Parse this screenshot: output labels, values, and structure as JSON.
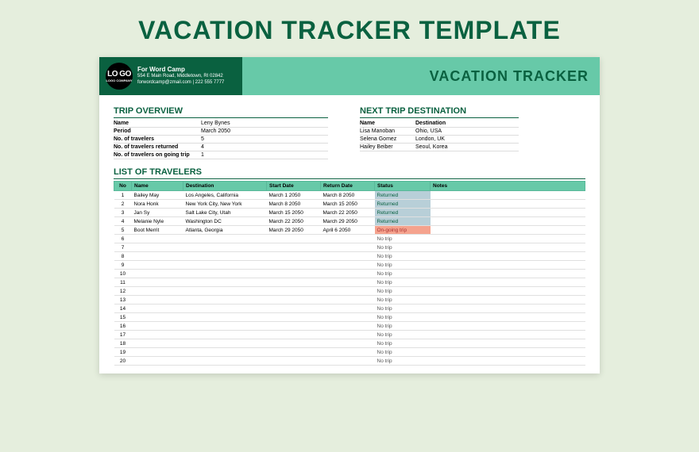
{
  "pageTitle": "VACATION TRACKER TEMPLATE",
  "header": {
    "logoMain": "LO GO",
    "logoSub": "LOGO COMPANY",
    "companyName": "For Word Camp",
    "address": "554 E Main Road, Middletown, RI 02842",
    "contact": "forwordcamp@zmail.com | 222 555 7777",
    "trackerTitle": "VACATION TRACKER"
  },
  "overview": {
    "title": "TRIP OVERVIEW",
    "rows": [
      {
        "label": "Name",
        "value": "Leny Bynes"
      },
      {
        "label": "Period",
        "value": "March 2050"
      },
      {
        "label": "No. of travelers",
        "value": "5"
      },
      {
        "label": "No. of travelers returned",
        "value": "4"
      },
      {
        "label": "No. of travelers on going trip",
        "value": "1"
      }
    ]
  },
  "nextTrip": {
    "title": "NEXT TRIP DESTINATION",
    "hName": "Name",
    "hDest": "Destination",
    "rows": [
      {
        "name": "Lisa Manoban",
        "dest": "Ohio, USA"
      },
      {
        "name": "Selena Gomez",
        "dest": "London, UK"
      },
      {
        "name": "Hailey Beiber",
        "dest": "Seoul, Korea"
      }
    ]
  },
  "travelers": {
    "title": "LIST OF TRAVELERS",
    "headers": {
      "no": "No",
      "name": "Name",
      "dest": "Destination",
      "start": "Start Date",
      "return": "Return Date",
      "status": "Status",
      "notes": "Notes"
    },
    "rows": [
      {
        "no": "1",
        "name": "Bailey May",
        "dest": "Los Angeles, California",
        "start": "March 1 2050",
        "return": "March 8 2050",
        "status": "Returned",
        "statusClass": "status-returned"
      },
      {
        "no": "2",
        "name": "Nora Honk",
        "dest": "New York City, New York",
        "start": "March 8 2050",
        "return": "March 15 2050",
        "status": "Returned",
        "statusClass": "status-returned"
      },
      {
        "no": "3",
        "name": "Jan Sy",
        "dest": "Salt Lake City, Utah",
        "start": "March 15 2050",
        "return": "March 22 2050",
        "status": "Returned",
        "statusClass": "status-returned"
      },
      {
        "no": "4",
        "name": "Melanie Nyle",
        "dest": "Washington DC",
        "start": "March 22 2050",
        "return": "March 29 2050",
        "status": "Returned",
        "statusClass": "status-returned"
      },
      {
        "no": "5",
        "name": "Boot Merrit",
        "dest": "Atlanta, Georgia",
        "start": "March 29 2050",
        "return": "April 6 2050",
        "status": "On-going trip",
        "statusClass": "status-ongoing"
      },
      {
        "no": "6",
        "status": "No trip",
        "statusClass": "status-notrip"
      },
      {
        "no": "7",
        "status": "No trip",
        "statusClass": "status-notrip"
      },
      {
        "no": "8",
        "status": "No trip",
        "statusClass": "status-notrip"
      },
      {
        "no": "9",
        "status": "No trip",
        "statusClass": "status-notrip"
      },
      {
        "no": "10",
        "status": "No trip",
        "statusClass": "status-notrip"
      },
      {
        "no": "11",
        "status": "No trip",
        "statusClass": "status-notrip"
      },
      {
        "no": "12",
        "status": "No trip",
        "statusClass": "status-notrip"
      },
      {
        "no": "13",
        "status": "No trip",
        "statusClass": "status-notrip"
      },
      {
        "no": "14",
        "status": "No trip",
        "statusClass": "status-notrip"
      },
      {
        "no": "15",
        "status": "No trip",
        "statusClass": "status-notrip"
      },
      {
        "no": "16",
        "status": "No trip",
        "statusClass": "status-notrip"
      },
      {
        "no": "17",
        "status": "No trip",
        "statusClass": "status-notrip"
      },
      {
        "no": "18",
        "status": "No trip",
        "statusClass": "status-notrip"
      },
      {
        "no": "19",
        "status": "No trip",
        "statusClass": "status-notrip"
      },
      {
        "no": "20",
        "status": "No trip",
        "statusClass": "status-notrip"
      }
    ]
  }
}
